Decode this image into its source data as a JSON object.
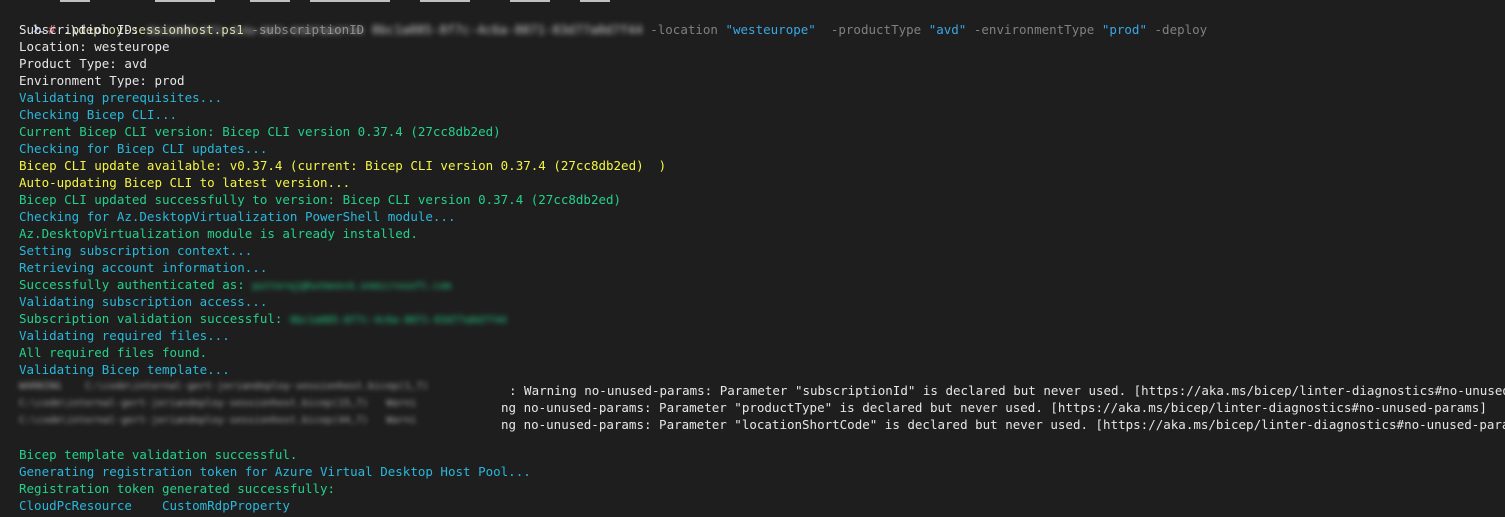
{
  "colors": {
    "background": "#1e1e1e",
    "default_text": "#e6e6e6",
    "info": "#29b8db",
    "success": "#23d18b",
    "warning": "#f5f543",
    "string": "#3aa6e6"
  },
  "command": {
    "hash": "#",
    "script": ".\\deploy-sessionhost.ps1",
    "p1": "-subscriptionID",
    "v1_redacted": "0bc1a085-8f7c-4c6a-8071-83d77a0d7f44",
    "p2": "-location",
    "v2": "\"westeurope\"",
    "p3": "-productType",
    "v3": "\"avd\"",
    "p4": "-environmentType",
    "v4": "\"prod\"",
    "p5": "-deploy"
  },
  "lines": {
    "sub_label": "Subscription ID:",
    "sub_value_redacted": "0bc1a085-8f7c-4c6a-8071-83d77a0d7f44",
    "location": "Location: westeurope",
    "product": "Product Type: avd",
    "env": "Environment Type: prod",
    "l5": "Validating prerequisites...",
    "l6": "Checking Bicep CLI...",
    "l7": "Current Bicep CLI version: Bicep CLI version 0.37.4 (27cc8db2ed)",
    "l8": "Checking for Bicep CLI updates...",
    "l9": "Bicep CLI update available: v0.37.4 (current: Bicep CLI version 0.37.4 (27cc8db2ed)  )",
    "l10": "Auto-updating Bicep CLI to latest version...",
    "l11": "Bicep CLI updated successfully to version: Bicep CLI version 0.37.4 (27cc8db2ed)",
    "l12": "Checking for Az.DesktopVirtualization PowerShell module...",
    "l13": "Az.DesktopVirtualization module is already installed.",
    "l14": "Setting subscription context...",
    "l15": "Retrieving account information...",
    "l16_label": "Successfully authenticated as:",
    "l16_value_redacted": "putterqj@hutmonck.onmicrosoft.com",
    "l17": "Validating subscription access...",
    "l18_label": "Subscription validation successful:",
    "l18_value_redacted": "0bc1a085-8f7c-4c6a-8071-83d77a0d7f44",
    "l19": "Validating required files...",
    "l20": "All required files found.",
    "l21": "Validating Bicep template...",
    "w1_prefix_redacted": "WARNING    C:\\code\\internal-gert-jeriandeploy-sessionhost.bicep(1,7) ",
    "w1_text": ": Warning no-unused-params: Parameter \"subscriptionId\" is declared but never used. [https://aka.ms/bicep/linter-diagnostics#no-unused-params]",
    "w2_prefix_redacted": "C:\\code\\internal-gert-jeriandeploy-sessionhost.bicep(15,7)   Warni",
    "w2_text": "ng no-unused-params: Parameter \"productType\" is declared but never used. [https://aka.ms/bicep/linter-diagnostics#no-unused-params]",
    "w3_prefix_redacted": "C:\\code\\internal-gert-jeriandeploy-sessionhost.bicep(44,7)   Warni",
    "w3_text": "ng no-unused-params: Parameter \"locationShortCode\" is declared but never used. [https://aka.ms/bicep/linter-diagnostics#no-unused-params]",
    "l25": "Bicep template validation successful.",
    "l26": "Generating registration token for Azure Virtual Desktop Host Pool...",
    "l27": "Registration token generated successfully:",
    "l28": "CloudPcResource    CustomRdpProperty"
  }
}
